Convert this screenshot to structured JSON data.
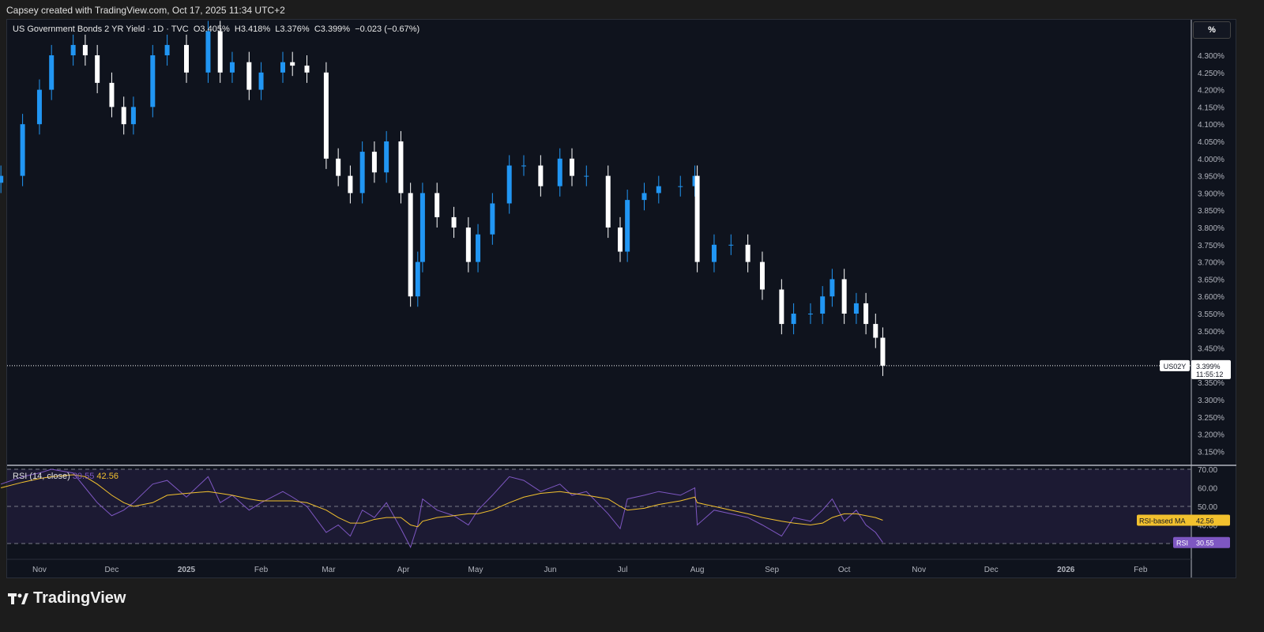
{
  "caption": "Capsey created with TradingView.com, Oct 17, 2025 11:34 UTC+2",
  "legend": {
    "symbol": "US Government Bonds 2 YR Yield · 1D · TVC",
    "open": "O3.405%",
    "high": "H3.418%",
    "low": "L3.376%",
    "close": "C3.399%",
    "change": "−0.023 (−0.67%)"
  },
  "scale_button": "%",
  "last_price": {
    "ticker": "US02Y",
    "value": "3.399%",
    "countdown": "11:55:12"
  },
  "rsi_legend": {
    "name": "RSI (14, close)",
    "rsi": "30.55",
    "ma": "42.56"
  },
  "rsi_badges": {
    "ma_label": "RSI-based MA",
    "ma_value": "42.56",
    "rsi_label": "RSI",
    "rsi_value": "30.55"
  },
  "colors": {
    "up": "#2196f3",
    "down": "#ffffff",
    "rsi": "#7e57c2",
    "rsi_ma": "#f2c12e",
    "background": "#0f131d"
  },
  "logo": "TradingView",
  "chart_data": {
    "type": "candlestick",
    "title": "US Government Bonds 2 YR Yield · 1D · TVC",
    "ylim": [
      3.13,
      4.4
    ],
    "yticks": [
      "4.300%",
      "4.250%",
      "4.200%",
      "4.150%",
      "4.100%",
      "4.050%",
      "4.000%",
      "3.950%",
      "3.900%",
      "3.850%",
      "3.800%",
      "3.750%",
      "3.700%",
      "3.650%",
      "3.600%",
      "3.550%",
      "3.500%",
      "3.450%",
      "3.350%",
      "3.300%",
      "3.250%",
      "3.200%",
      "3.150%"
    ],
    "ytick_values": [
      4.3,
      4.25,
      4.2,
      4.15,
      4.1,
      4.05,
      4.0,
      3.95,
      3.9,
      3.85,
      3.8,
      3.75,
      3.7,
      3.65,
      3.6,
      3.55,
      3.5,
      3.45,
      3.35,
      3.3,
      3.25,
      3.2,
      3.15
    ],
    "xticks": [
      {
        "label": "Nov",
        "date": "2024-11-01"
      },
      {
        "label": "Dec",
        "date": "2024-12-01"
      },
      {
        "label": "2025",
        "date": "2025-01-01"
      },
      {
        "label": "Feb",
        "date": "2025-02-01"
      },
      {
        "label": "Mar",
        "date": "2025-03-01"
      },
      {
        "label": "Apr",
        "date": "2025-04-01"
      },
      {
        "label": "May",
        "date": "2025-05-01"
      },
      {
        "label": "Jun",
        "date": "2025-06-01"
      },
      {
        "label": "Jul",
        "date": "2025-07-01"
      },
      {
        "label": "Aug",
        "date": "2025-08-01"
      },
      {
        "label": "Sep",
        "date": "2025-09-01"
      },
      {
        "label": "Oct",
        "date": "2025-10-01"
      },
      {
        "label": "Nov",
        "date": "2025-11-01"
      },
      {
        "label": "Dec",
        "date": "2025-12-01"
      },
      {
        "label": "2026",
        "date": "2026-01-01"
      },
      {
        "label": "Feb",
        "date": "2026-02-01"
      }
    ],
    "dates": [
      "2024-10-16",
      "2024-10-25",
      "2024-11-01",
      "2024-11-06",
      "2024-11-15",
      "2024-11-20",
      "2024-11-25",
      "2024-12-01",
      "2024-12-06",
      "2024-12-10",
      "2024-12-18",
      "2024-12-24",
      "2025-01-01",
      "2025-01-10",
      "2025-01-15",
      "2025-01-20",
      "2025-01-27",
      "2025-02-01",
      "2025-02-10",
      "2025-02-14",
      "2025-02-20",
      "2025-02-28",
      "2025-03-05",
      "2025-03-10",
      "2025-03-15",
      "2025-03-20",
      "2025-03-25",
      "2025-03-31",
      "2025-04-04",
      "2025-04-07",
      "2025-04-09",
      "2025-04-15",
      "2025-04-22",
      "2025-04-28",
      "2025-05-02",
      "2025-05-08",
      "2025-05-15",
      "2025-05-21",
      "2025-05-28",
      "2025-06-05",
      "2025-06-10",
      "2025-06-16",
      "2025-06-25",
      "2025-06-30",
      "2025-07-03",
      "2025-07-10",
      "2025-07-16",
      "2025-07-25",
      "2025-07-31",
      "2025-08-01",
      "2025-08-08",
      "2025-08-15",
      "2025-08-22",
      "2025-08-28",
      "2025-09-05",
      "2025-09-10",
      "2025-09-17",
      "2025-09-22",
      "2025-09-26",
      "2025-10-01",
      "2025-10-06",
      "2025-10-10",
      "2025-10-14",
      "2025-10-17"
    ],
    "close": [
      3.95,
      4.1,
      4.2,
      4.3,
      4.33,
      4.3,
      4.22,
      4.15,
      4.1,
      4.15,
      4.3,
      4.33,
      4.25,
      4.37,
      4.25,
      4.28,
      4.2,
      4.25,
      4.28,
      4.27,
      4.25,
      4.0,
      3.95,
      3.9,
      4.02,
      3.96,
      4.05,
      3.9,
      3.6,
      3.7,
      3.9,
      3.83,
      3.8,
      3.7,
      3.78,
      3.87,
      3.98,
      3.98,
      3.92,
      4.0,
      3.95,
      3.95,
      3.8,
      3.73,
      3.88,
      3.9,
      3.92,
      3.92,
      3.95,
      3.7,
      3.75,
      3.75,
      3.7,
      3.62,
      3.52,
      3.55,
      3.55,
      3.6,
      3.65,
      3.55,
      3.58,
      3.52,
      3.48,
      3.399
    ],
    "rsi": [
      62,
      66,
      68,
      70,
      68,
      60,
      52,
      45,
      48,
      52,
      62,
      64,
      55,
      66,
      52,
      56,
      48,
      52,
      58,
      55,
      50,
      36,
      40,
      34,
      48,
      44,
      52,
      38,
      28,
      40,
      54,
      48,
      45,
      40,
      48,
      56,
      66,
      64,
      58,
      62,
      56,
      58,
      46,
      38,
      54,
      56,
      58,
      56,
      60,
      40,
      48,
      46,
      44,
      40,
      34,
      44,
      42,
      48,
      54,
      42,
      48,
      40,
      36,
      30.55
    ],
    "rsi_ma": [
      60,
      63,
      65,
      66,
      67,
      66,
      62,
      56,
      52,
      50,
      52,
      56,
      57,
      58,
      57,
      56,
      54,
      53,
      53,
      53,
      52,
      48,
      44,
      41,
      41,
      43,
      44,
      44,
      40,
      39,
      42,
      44,
      45,
      46,
      46,
      48,
      52,
      55,
      57,
      58,
      57,
      56,
      54,
      50,
      48,
      49,
      51,
      53,
      55,
      52,
      50,
      48,
      46,
      44,
      42,
      41,
      40,
      41,
      44,
      46,
      46,
      45,
      44,
      42.56
    ],
    "rsi_levels": [
      70,
      50,
      30
    ],
    "rsi_yticks": [
      "70.00",
      "60.00",
      "50.00",
      "40.00"
    ]
  }
}
